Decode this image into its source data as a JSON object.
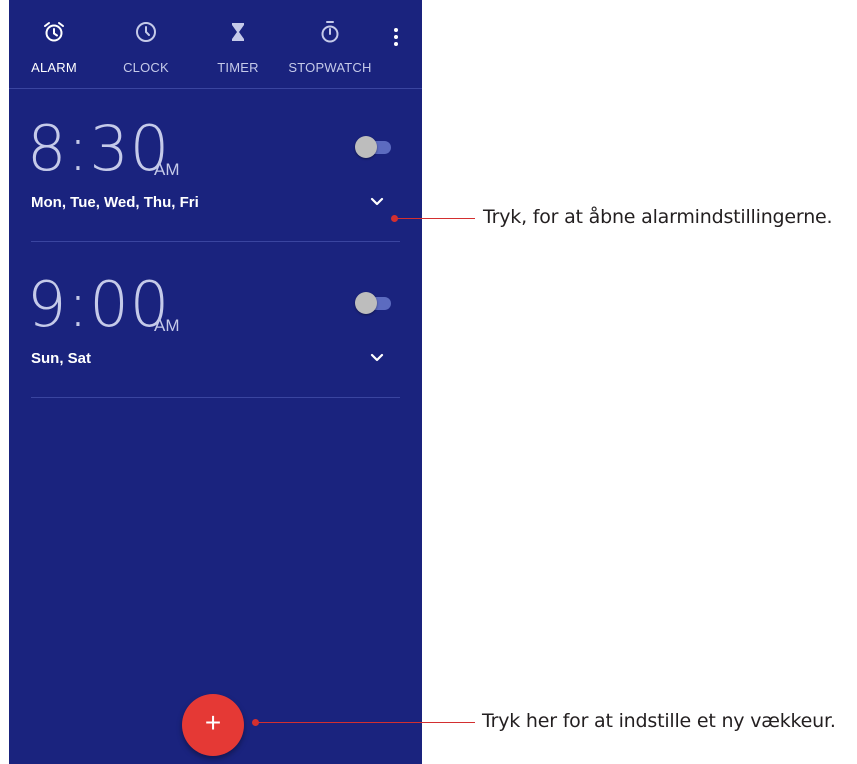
{
  "tabs": [
    {
      "label": "ALARM",
      "icon": "alarm-clock-icon"
    },
    {
      "label": "CLOCK",
      "icon": "clock-icon"
    },
    {
      "label": "TIMER",
      "icon": "hourglass-icon"
    },
    {
      "label": "STOPWATCH",
      "icon": "stopwatch-icon"
    }
  ],
  "active_tab": "ALARM",
  "alarms": [
    {
      "time": "8:30",
      "period": "AM",
      "days": "Mon, Tue, Wed, Thu, Fri",
      "enabled": false
    },
    {
      "time": "9:00",
      "period": "AM",
      "days": "Sun, Sat",
      "enabled": false
    }
  ],
  "fab": {
    "label": "+"
  },
  "callouts": {
    "settings": "Tryk, for at åbne alarmindstillingerne.",
    "new_alarm": "Tryk her for at indstille et ny vækkeur."
  },
  "colors": {
    "background": "#1a237e",
    "fab": "#e53935",
    "callout": "#d32f2f"
  }
}
